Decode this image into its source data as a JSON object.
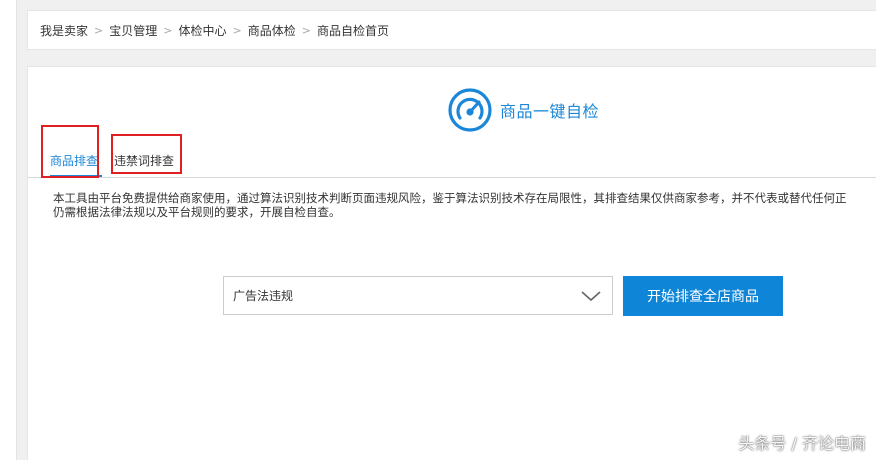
{
  "breadcrumb": {
    "items": [
      "我是卖家",
      "宝贝管理",
      "体检中心",
      "商品体检",
      "商品自检首页"
    ],
    "separator": ">"
  },
  "hero": {
    "title": "商品一键自检",
    "icon": "radar-gauge-icon"
  },
  "tabs": [
    {
      "label": "商品排查",
      "active": true
    },
    {
      "label": "违禁词排查",
      "active": false
    }
  ],
  "notice": {
    "line1": "本工具由平台免费提供给商家使用，通过算法识别技术判断页面违规风险，鉴于算法识别技术存在局限性，其排查结果仅供商家参考，并不代表或替代任何正",
    "line2": "仍需根据法律法规以及平台规则的要求，开展自检自查。"
  },
  "select": {
    "value": "广告法违规",
    "icon": "chevron-down-icon"
  },
  "start_button": {
    "label": "开始排查全店商品"
  },
  "watermark": {
    "text": "头条号 / 齐论电商"
  },
  "colors": {
    "accent": "#1a87d8",
    "button": "#0f85d8",
    "annotation": "#e02020"
  }
}
